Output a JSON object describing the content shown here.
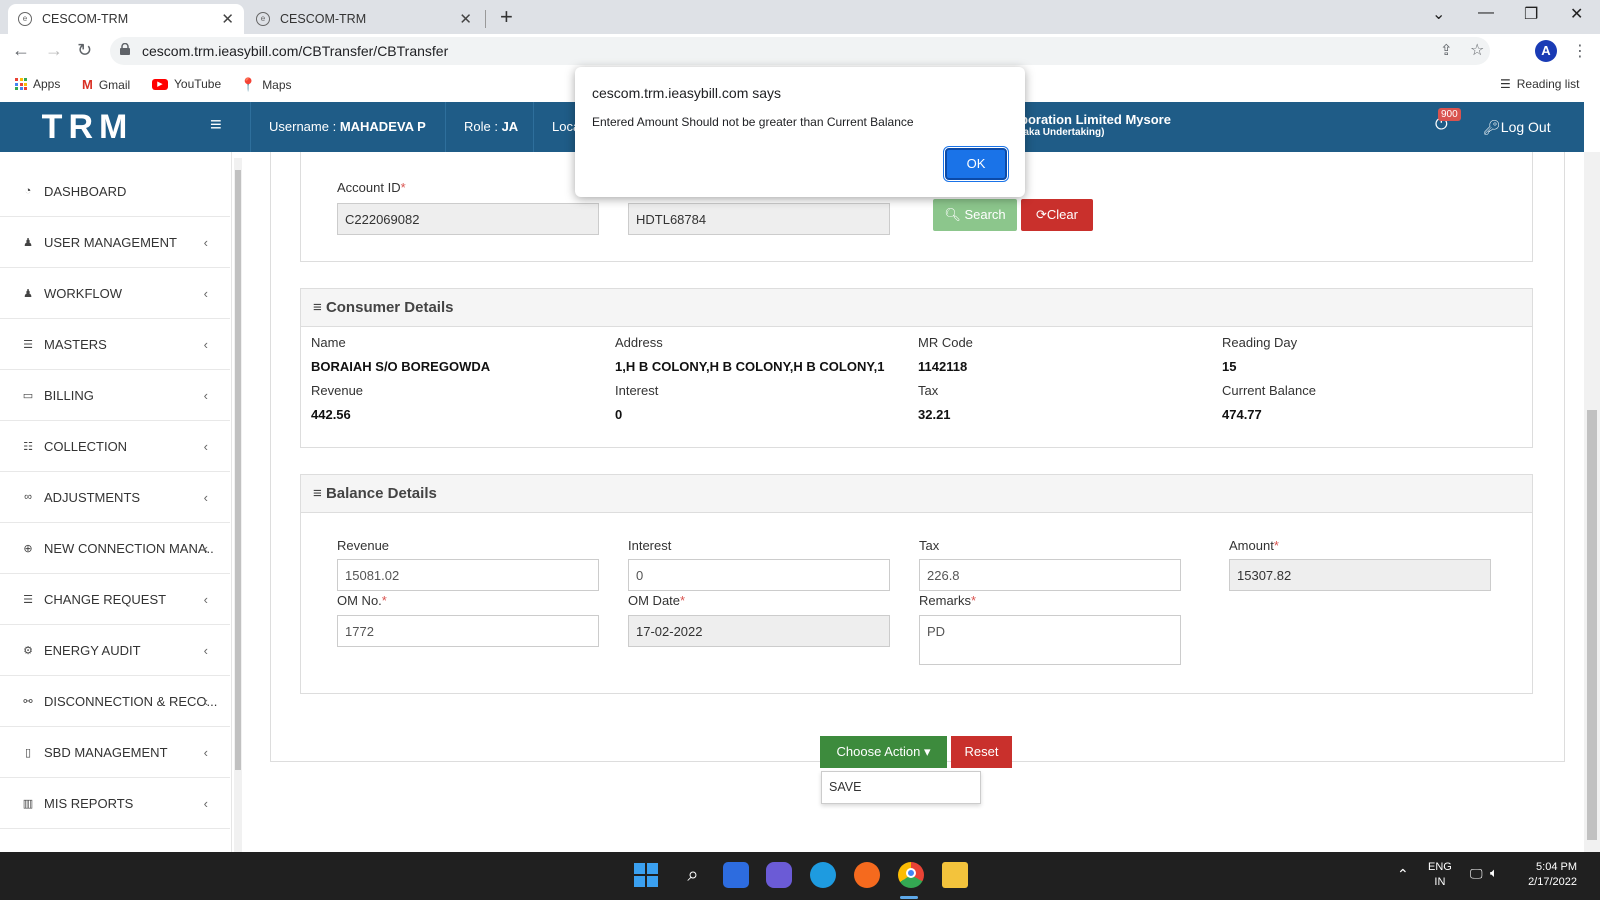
{
  "browser": {
    "tabs": [
      {
        "title": "CESCOM-TRM",
        "active": true
      },
      {
        "title": "CESCOM-TRM",
        "active": false
      }
    ],
    "url": "cescom.trm.ieasybill.com/CBTransfer/CBTransfer",
    "profile_initial": "A",
    "bookmarks": [
      "Apps",
      "Gmail",
      "YouTube",
      "Maps"
    ],
    "reading_list": "Reading list"
  },
  "header": {
    "brand": "TRM",
    "username_label": "Username : ",
    "username": "MAHADEVA P",
    "role_label": "Role : ",
    "role": "JA",
    "location_partial": "Loca",
    "company": "poration Limited Mysore",
    "company_sub": "taka Undertaking)",
    "notification_count": "900",
    "logout": "Log Out"
  },
  "sidebar": {
    "items": [
      {
        "label": "DASHBOARD",
        "icon": "tachometer-icon",
        "chevron": false
      },
      {
        "label": "USER MANAGEMENT",
        "icon": "user-icon",
        "chevron": true
      },
      {
        "label": "WORKFLOW",
        "icon": "user-icon",
        "chevron": true
      },
      {
        "label": "MASTERS",
        "icon": "list-icon",
        "chevron": true
      },
      {
        "label": "BILLING",
        "icon": "monitor-icon",
        "chevron": true
      },
      {
        "label": "COLLECTION",
        "icon": "list-ordered-icon",
        "chevron": true
      },
      {
        "label": "ADJUSTMENTS",
        "icon": "binoculars-icon",
        "chevron": true
      },
      {
        "label": "NEW CONNECTION MANA..",
        "icon": "plus-circle-icon",
        "chevron": true
      },
      {
        "label": "CHANGE REQUEST",
        "icon": "list-icon",
        "chevron": true
      },
      {
        "label": "ENERGY AUDIT",
        "icon": "cogs-icon",
        "chevron": true
      },
      {
        "label": "DISCONNECTION & RECO...",
        "icon": "unlink-icon",
        "chevron": true
      },
      {
        "label": "SBD MANAGEMENT",
        "icon": "mobile-icon",
        "chevron": true
      },
      {
        "label": "MIS REPORTS",
        "icon": "bar-chart-icon",
        "chevron": true
      }
    ]
  },
  "search_section": {
    "account_id_label": "Account ID",
    "account_id": "C222069082",
    "second_value": "HDTL68784",
    "search_button": "Search",
    "clear_button": "Clear"
  },
  "consumer_details": {
    "title": "Consumer Details",
    "fields": [
      {
        "label": "Name",
        "value": "BORAIAH S/O BOREGOWDA"
      },
      {
        "label": "Address",
        "value": "1,H B COLONY,H B COLONY,H B COLONY,1"
      },
      {
        "label": "MR Code",
        "value": "1142118"
      },
      {
        "label": "Reading Day",
        "value": "15"
      },
      {
        "label": "Revenue",
        "value": "442.56"
      },
      {
        "label": "Interest",
        "value": "0"
      },
      {
        "label": "Tax",
        "value": "32.21"
      },
      {
        "label": "Current Balance",
        "value": "474.77"
      }
    ]
  },
  "balance_details": {
    "title": "Balance Details",
    "revenue_label": "Revenue",
    "revenue": "15081.02",
    "interest_label": "Interest",
    "interest": "0",
    "tax_label": "Tax",
    "tax": "226.8",
    "amount_label": "Amount",
    "amount": "15307.82",
    "om_no_label": "OM No.",
    "om_no": "1772",
    "om_date_label": "OM Date",
    "om_date": "17-02-2022",
    "remarks_label": "Remarks",
    "remarks": "PD"
  },
  "actions": {
    "choose_action": "Choose Action",
    "reset": "Reset",
    "dropdown_options": [
      "SAVE"
    ]
  },
  "dialog": {
    "title": "cescom.trm.ieasybill.com says",
    "message": "Entered Amount Should not be greater than Current Balance",
    "ok": "OK"
  },
  "taskbar": {
    "lang": "ENG",
    "region": "IN",
    "time": "5:04 PM",
    "date": "2/17/2022"
  },
  "colors": {
    "header_blue": "#1f5c87",
    "success_green": "#3d8b3d",
    "danger_red": "#c9302c",
    "dialog_blue": "#1a73e8"
  }
}
